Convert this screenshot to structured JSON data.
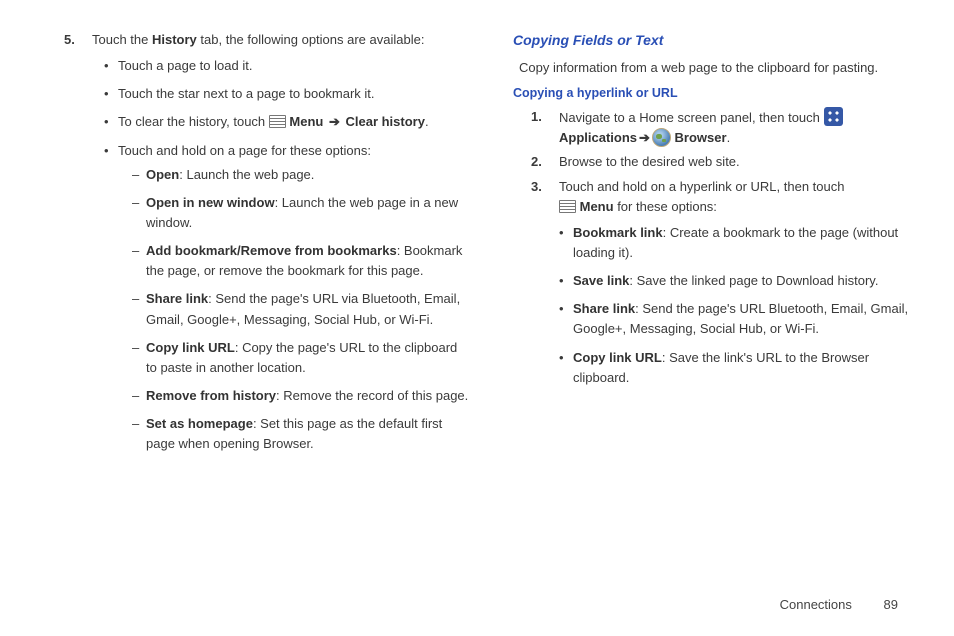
{
  "left": {
    "step5_num": "5.",
    "step5_pre": "Touch the ",
    "step5_b1": "History",
    "step5_post": " tab, the following options are available:",
    "b1": "Touch a page to load it.",
    "b2": "Touch the star next to a page to bookmark it.",
    "b3_pre": "To clear the history, touch ",
    "b3_menu": "Menu ",
    "b3_arrow": "➔",
    "b3_clear": " Clear history",
    "b3_dot": ".",
    "b4": "Touch and hold on a page for these options:",
    "d1_b": "Open",
    "d1_t": ": Launch the web page.",
    "d2_b": "Open in new window",
    "d2_t": ": Launch the web page in a new window.",
    "d3_b": "Add bookmark/Remove from bookmarks",
    "d3_t": ": Bookmark the page, or remove the bookmark for this page.",
    "d4_b": "Share link",
    "d4_t": ": Send the page's URL via Bluetooth, Email, Gmail, Google+, Messaging, Social Hub, or Wi-Fi.",
    "d5_b": "Copy link URL",
    "d5_t": ": Copy the page's URL to the clipboard to paste in another location.",
    "d6_b": "Remove from history",
    "d6_t": ": Remove the record of this page.",
    "d7_b": "Set as homepage",
    "d7_t": ": Set this page as the default first page when opening Browser."
  },
  "right": {
    "h1": "Copying Fields or Text",
    "intro": "Copy information from a web page to the clipboard for pasting.",
    "h2": "Copying a hyperlink or URL",
    "s1_num": "1.",
    "s1_pre": "Navigate to a Home screen panel, then touch ",
    "s1_apps_b": "Applications",
    "s1_arrow": " ➔ ",
    "s1_browser_b": " Browser",
    "s1_dot": ".",
    "s2_num": "2.",
    "s2_t": "Browse to the desired web site.",
    "s3_num": "3.",
    "s3_pre": "Touch and hold on a hyperlink or URL, then touch ",
    "s3_menu_b": "Menu",
    "s3_post": " for these options:",
    "b1_b": "Bookmark link",
    "b1_t": ": Create a bookmark to the page (without loading it).",
    "b2_b": "Save link",
    "b2_t": ": Save the linked page to Download history.",
    "b3_b": "Share link",
    "b3_t": ": Send the page's URL Bluetooth, Email, Gmail, Google+, Messaging, Social Hub, or Wi-Fi.",
    "b4_b": "Copy link URL",
    "b4_t": ": Save the link's URL to the Browser clipboard."
  },
  "footer": {
    "section": "Connections",
    "page": "89"
  }
}
